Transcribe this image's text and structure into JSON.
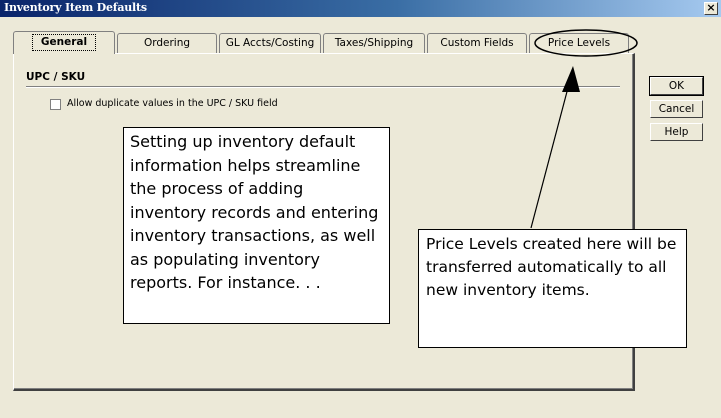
{
  "window": {
    "title": "Inventory Item Defaults",
    "close_glyph": "×",
    "close_icon": "close-icon"
  },
  "tabs": [
    {
      "label": "General",
      "active": true
    },
    {
      "label": "Ordering",
      "active": false
    },
    {
      "label": "GL Accts/Costing",
      "active": false
    },
    {
      "label": "Taxes/Shipping",
      "active": false
    },
    {
      "label": "Custom Fields",
      "active": false
    },
    {
      "label": "Price Levels",
      "active": false,
      "highlighted": true
    }
  ],
  "section": {
    "title": "UPC / SKU",
    "checkbox_label": "Allow duplicate values in the UPC / SKU field",
    "checkbox_checked": false
  },
  "buttons": {
    "ok": "OK",
    "cancel": "Cancel",
    "help": "Help"
  },
  "callouts": {
    "left": "Setting up inventory default information helps streamline the process of adding inventory records and entering inventory transactions, as well as populating inventory reports. For instance. . .",
    "right": "Price Levels created here will be transferred automatically to all new inventory items."
  },
  "colors": {
    "face": "#ece9d8",
    "title_start": "#0a246a",
    "title_end": "#a6caf0",
    "callout_border": "#000000"
  }
}
